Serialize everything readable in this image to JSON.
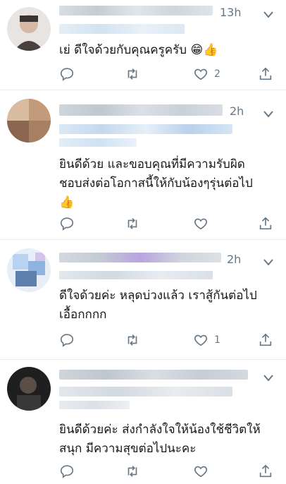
{
  "tweets": [
    {
      "time": "13h",
      "text_lines": [
        "เย่ ดีใจด้วยกับคุณครูครับ 😁👍"
      ],
      "like_count": "2",
      "colors": {
        "avatar": [
          "#d9d4d2",
          "#9b8f8b",
          "#4a403e"
        ]
      }
    },
    {
      "time": "2h",
      "text_lines": [
        "ยินดีด้วย และขอบคุณที่มีความรับผิด",
        "ชอบส่งต่อโอกาสนี้ให้กับน้องๆรุ่นต่อไป",
        "👍"
      ],
      "like_count": "",
      "colors": {
        "avatar": [
          "#d8b99a",
          "#b08a6a",
          "#7b5a45"
        ]
      }
    },
    {
      "time": "2h",
      "text_lines": [
        "ดีใจด้วยค่ะ หลุดบ่วงแล้ว เราสู้กันต่อไป",
        "เอื้อกกกก"
      ],
      "like_count": "1",
      "colors": {
        "avatar": [
          "#c6d9f2",
          "#a7c7e8",
          "#4b6c9a"
        ]
      }
    },
    {
      "time": "",
      "text_lines": [
        "ยินดีด้วยค่ะ ส่งกำลังใจให้น้องใช้ชีวิตให้",
        "สนุก มีความสุขต่อไปนะคะ"
      ],
      "like_count": "",
      "colors": {
        "avatar": [
          "#2b2b2b",
          "#555555",
          "#8a7a6a"
        ]
      }
    }
  ],
  "icons": {
    "reply": "reply-icon",
    "retweet": "retweet-icon",
    "like": "heart-icon",
    "share": "share-icon",
    "menu": "chevron-down-icon"
  },
  "colors": {
    "icon_gray": "#657786",
    "divider": "#e6ecf0",
    "text": "#14171a"
  }
}
